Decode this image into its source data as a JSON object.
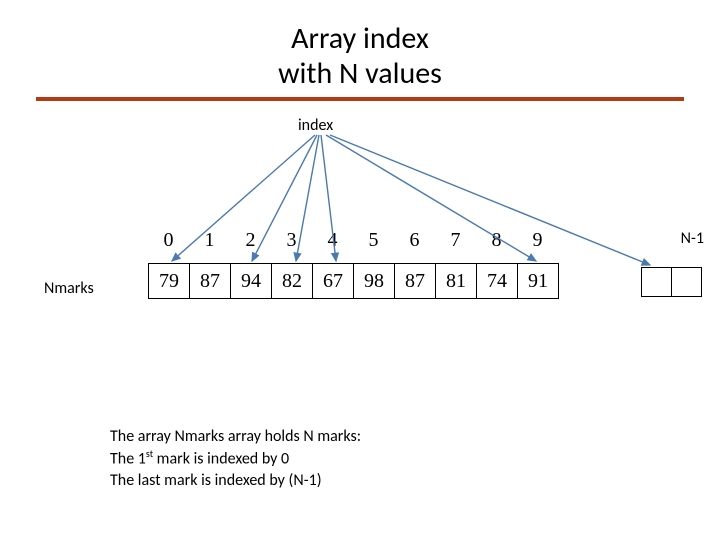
{
  "title_line1": "Array index",
  "title_line2": "with N values",
  "labels": {
    "index": "index",
    "n_minus_1": "N-1",
    "nmarks": "Nmarks"
  },
  "indices": [
    "0",
    "1",
    "2",
    "3",
    "4",
    "5",
    "6",
    "7",
    "8",
    "9"
  ],
  "values": [
    "79",
    "87",
    "94",
    "82",
    "67",
    "98",
    "87",
    "81",
    "74",
    "91"
  ],
  "caption": {
    "l1": "The array Nmarks array holds N marks:",
    "l2_prefix": "The 1",
    "l2_sup": "st",
    "l2_rest": " mark is indexed by 0",
    "l3": "The last mark is indexed by (N-1)"
  }
}
